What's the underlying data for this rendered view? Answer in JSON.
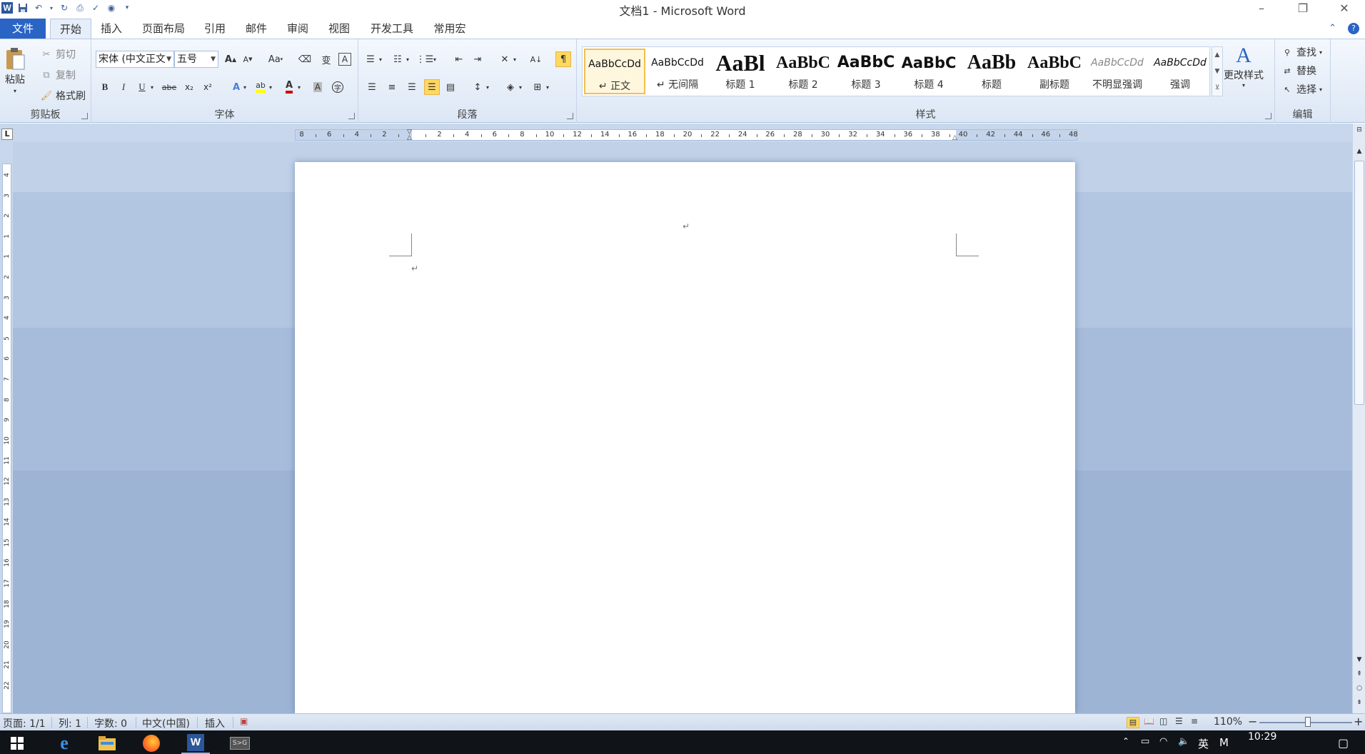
{
  "window": {
    "title": "文档1 - Microsoft Word",
    "app_icon_letter": "W",
    "qat_icons": [
      "save-icon",
      "undo-icon",
      "redo-icon",
      "print-preview-icon",
      "spelling-icon",
      "office-icon",
      "customize-qat-icon"
    ],
    "controls": {
      "minimize": "–",
      "restore": "❐",
      "close": "✕"
    }
  },
  "tabs": {
    "file": "文件",
    "items": [
      "开始",
      "插入",
      "页面布局",
      "引用",
      "邮件",
      "审阅",
      "视图",
      "开发工具",
      "常用宏"
    ],
    "active": "开始"
  },
  "clipboard": {
    "label": "剪贴板",
    "paste": "粘贴",
    "cut": "剪切",
    "copy": "复制",
    "format_painter": "格式刷"
  },
  "font": {
    "label": "字体",
    "name": "宋体 (中文正文",
    "size": "五号",
    "bold": "B",
    "italic": "I",
    "underline": "U",
    "strike": "abe",
    "subscript": "x₂",
    "superscript": "x²",
    "grow": "A",
    "shrink": "A",
    "case": "Aa",
    "font_color": "#d20000",
    "highlight_color": "#ffff00"
  },
  "paragraph": {
    "label": "段落"
  },
  "styles": {
    "label": "样式",
    "items": [
      {
        "preview": "AaBbCcDd",
        "name": "↵ 正文",
        "selected": true
      },
      {
        "preview": "AaBbCcDd",
        "name": "↵ 无间隔",
        "selected": false
      },
      {
        "preview": "AaBl",
        "name": "标题 1",
        "selected": false
      },
      {
        "preview": "AaBbC",
        "name": "标题 2",
        "selected": false
      },
      {
        "preview": "AaBbC",
        "name": "标题 3",
        "selected": false
      },
      {
        "preview": "AaBbC",
        "name": "标题 4",
        "selected": false
      },
      {
        "preview": "AaBb",
        "name": "标题",
        "selected": false
      },
      {
        "preview": "AaBbC",
        "name": "副标题",
        "selected": false
      },
      {
        "preview": "AaBbCcDd",
        "name": "不明显强调",
        "selected": false
      },
      {
        "preview": "AaBbCcDd",
        "name": "强调",
        "selected": false
      }
    ],
    "change_styles": "更改样式"
  },
  "editing": {
    "label": "编辑",
    "find": "查找",
    "replace": "替换",
    "select": "选择"
  },
  "ruler": {
    "left_numbers": [
      "8",
      "6",
      "4",
      "2"
    ],
    "right_numbers": [
      "2",
      "4",
      "6",
      "8",
      "10",
      "12",
      "14",
      "16",
      "18",
      "20",
      "22",
      "24",
      "26",
      "28",
      "30",
      "32",
      "34",
      "36",
      "38",
      "40",
      "42",
      "44",
      "46",
      "48"
    ],
    "vertical_numbers": [
      "4",
      "3",
      "2",
      "1",
      "1",
      "2",
      "3",
      "4",
      "5",
      "6",
      "7",
      "8",
      "9",
      "10",
      "11",
      "12",
      "13",
      "14",
      "15",
      "16",
      "17",
      "18",
      "19",
      "20",
      "21",
      "22"
    ],
    "tab_selector": "L"
  },
  "document": {
    "paragraph_mark": "↵"
  },
  "status": {
    "page": "页面: 1/1",
    "col": "列: 1",
    "words": "字数: 0",
    "lang": "中文(中国)",
    "mode": "插入",
    "zoom": "110%",
    "zoom_minus": "−",
    "zoom_plus": "+"
  },
  "taskbar": {
    "time": "10:29",
    "ime": "英",
    "ime2": "M",
    "apps": [
      "windows-start-icon",
      "edge-icon",
      "file-explorer-icon",
      "firefox-icon",
      "word-icon",
      "app-icon"
    ]
  }
}
